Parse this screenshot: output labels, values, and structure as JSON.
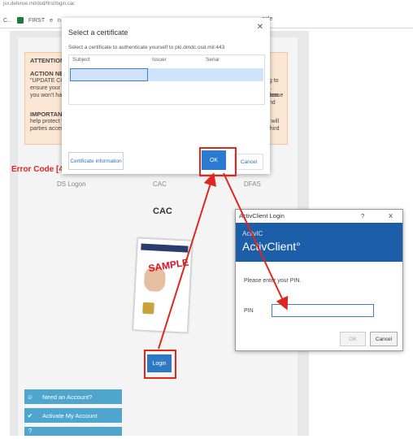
{
  "browser": {
    "url": "jsx.defense.mil/dod/first/login.cac",
    "bookmarks": [
      "C...",
      "FIRST",
      "e",
      "n"
    ],
    "right_bookmark": "ogle"
  },
  "notice": {
    "title": "ATTENTION A",
    "action_head": "ACTION NEE",
    "action_line1": "\"UPDATE CO",
    "action_line2": "ensure your pl",
    "action_line3": "you won't hav",
    "right1": "ng to",
    "right2": "ul. Please",
    "right3": "soon and",
    "important_head": "IMPORTANT:",
    "imp_line1": "help protect y",
    "imp_line2": "parties access",
    "imp_right1": "s. This will",
    "imp_right2": "ible third"
  },
  "error_code": "Error Code [4",
  "tabs": [
    "DS Logon",
    "CAC",
    "DFAS"
  ],
  "cac_heading": "CAC",
  "card": {
    "sample": "SAMPLE"
  },
  "login_button": "Login",
  "side_buttons": [
    {
      "icon": "user-icon",
      "glyph": "☺",
      "label": "Need an Account?"
    },
    {
      "icon": "check-icon",
      "glyph": "✔",
      "label": "Activate My Account"
    },
    {
      "icon": "help-icon",
      "glyph": "?",
      "label": ""
    }
  ],
  "cert_dialog": {
    "title": "Select a certificate",
    "subtitle": "Select a certificate to authenticate yourself to pki.dmdc.osd.mil:443",
    "columns": [
      "Subject",
      "Issuer",
      "Serial"
    ],
    "info_button": "Certificate information",
    "ok": "OK",
    "cancel": "Cancel",
    "close": "✕"
  },
  "activclient": {
    "window_title": "ActivClient Login",
    "help": "?",
    "close": "X",
    "brand_small": "ActivIC",
    "brand_big": "ActivClient°",
    "prompt": "Please enter your PIN.",
    "pin_label": "PIN",
    "ok": "OK",
    "cancel": "Cancel"
  },
  "colors": {
    "annotation_red": "#e0261f",
    "accent_blue": "#2a7ad1",
    "activclient_blue": "#1c5ea8",
    "side_blue": "#4ea6cf"
  }
}
